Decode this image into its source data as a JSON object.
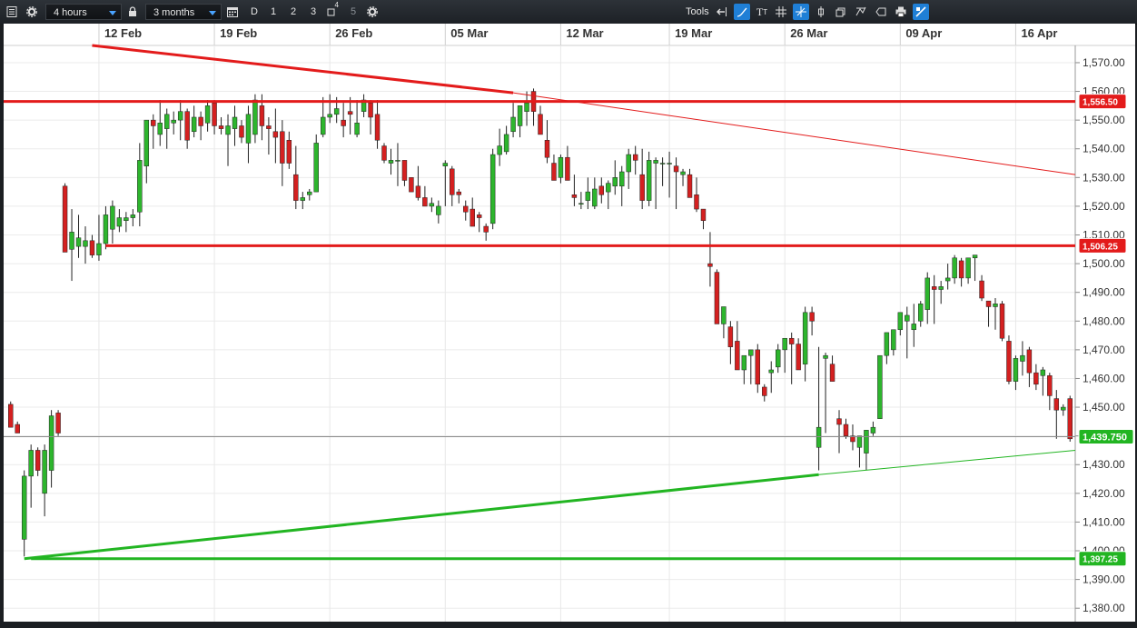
{
  "toolbar": {
    "interval": "4 hours",
    "range": "3 months",
    "periods": [
      "D",
      "1",
      "2",
      "3",
      "5"
    ],
    "period_superscript": "4",
    "tools_label": "Tools"
  },
  "colors": {
    "up": "#2db52d",
    "down": "#d42020",
    "resistance": "#e31b1b",
    "support": "#22b522",
    "last_price_bg": "#22b522"
  },
  "chart_data": {
    "type": "candlestick",
    "ylim": [
      1375,
      1576
    ],
    "y_ticks": [
      "1,570.00",
      "1,560.00",
      "1,550.00",
      "1,540.00",
      "1,530.00",
      "1,520.00",
      "1,510.00",
      "1,500.00",
      "1,490.00",
      "1,480.00",
      "1,470.00",
      "1,460.00",
      "1,450.00",
      "1,440.00",
      "1,430.00",
      "1,420.00",
      "1,410.00",
      "1,400.00",
      "1,390.00",
      "1,380.00"
    ],
    "x_labels": [
      "12 Feb",
      "19 Feb",
      "26 Feb",
      "05 Mar",
      "12 Mar",
      "19 Mar",
      "26 Mar",
      "09 Apr",
      "16 Apr"
    ],
    "price_tags": [
      {
        "label": "1,556.50",
        "value": 1556.5,
        "kind": "resistance"
      },
      {
        "label": "1,506.25",
        "value": 1506.25,
        "kind": "resistance"
      },
      {
        "label": "1,439.750",
        "value": 1439.75,
        "kind": "last"
      },
      {
        "label": "1,397.25",
        "value": 1397.25,
        "kind": "support"
      }
    ],
    "lines": [
      {
        "name": "upper-horizontal",
        "kind": "resistance",
        "y": 1556.5,
        "from_bar": 0,
        "to_bar": "end"
      },
      {
        "name": "middle-horizontal",
        "kind": "resistance",
        "y": 1506.25,
        "from_bar": 14,
        "to_bar": "end"
      },
      {
        "name": "lower-horizontal",
        "kind": "support",
        "y": 1397.25,
        "from_bar": 3,
        "to_bar": "end"
      },
      {
        "name": "last-price",
        "kind": "last",
        "y": 1439.75,
        "from_bar": 0,
        "to_bar": "end"
      },
      {
        "name": "descending-trendline",
        "kind": "resistance",
        "from": [
          12,
          1576
        ],
        "to": [
          74,
          1559.5
        ],
        "extend_to_y": 1531
      },
      {
        "name": "ascending-trendline",
        "kind": "support",
        "from": [
          2,
          1397.25
        ],
        "to": [
          119,
          1426.5
        ],
        "extend_to_y": 1435
      }
    ],
    "candles": [
      [
        1451,
        1452,
        1444,
        1443
      ],
      [
        1444,
        1445,
        1442,
        1441
      ],
      [
        1404,
        1428,
        1398,
        1426
      ],
      [
        1426,
        1437,
        1415,
        1435
      ],
      [
        1435,
        1436,
        1426,
        1428
      ],
      [
        1420,
        1437,
        1412,
        1435
      ],
      [
        1428,
        1449,
        1422,
        1447
      ],
      [
        1448,
        1449,
        1440,
        1441
      ],
      [
        1527,
        1528,
        1504,
        1504
      ],
      [
        1505,
        1519,
        1494,
        1511
      ],
      [
        1506,
        1517,
        1502,
        1509
      ],
      [
        1506,
        1513,
        1500,
        1508
      ],
      [
        1508,
        1510,
        1502,
        1503
      ],
      [
        1503,
        1517,
        1501,
        1507
      ],
      [
        1507,
        1520,
        1505,
        1517
      ],
      [
        1512,
        1522,
        1507,
        1520
      ],
      [
        1513,
        1519,
        1511,
        1516
      ],
      [
        1515,
        1518,
        1511,
        1516
      ],
      [
        1516,
        1519,
        1513,
        1517
      ],
      [
        1518,
        1542,
        1513,
        1536
      ],
      [
        1534,
        1550,
        1528,
        1550
      ],
      [
        1550,
        1552,
        1540,
        1548
      ],
      [
        1545,
        1557,
        1541,
        1549
      ],
      [
        1547,
        1554,
        1540,
        1552
      ],
      [
        1549,
        1553,
        1545,
        1550
      ],
      [
        1550,
        1557,
        1543,
        1553
      ],
      [
        1553,
        1554,
        1540,
        1543
      ],
      [
        1546,
        1555,
        1544,
        1551
      ],
      [
        1551,
        1553,
        1543,
        1548
      ],
      [
        1549,
        1557,
        1546,
        1555
      ],
      [
        1556,
        1557,
        1545,
        1548
      ],
      [
        1548,
        1551,
        1545,
        1547
      ],
      [
        1545,
        1552,
        1534,
        1548
      ],
      [
        1547,
        1555,
        1541,
        1551
      ],
      [
        1548,
        1550,
        1542,
        1544
      ],
      [
        1542,
        1555,
        1535,
        1552
      ],
      [
        1545,
        1559,
        1542,
        1557
      ],
      [
        1555,
        1559,
        1543,
        1548
      ],
      [
        1548,
        1551,
        1538,
        1547
      ],
      [
        1546,
        1554,
        1535,
        1544
      ],
      [
        1546,
        1550,
        1527,
        1535
      ],
      [
        1543,
        1546,
        1533,
        1535
      ],
      [
        1531,
        1541,
        1519,
        1522
      ],
      [
        1522,
        1525,
        1519,
        1523
      ],
      [
        1524,
        1526,
        1522,
        1525
      ],
      [
        1525,
        1545,
        1526,
        1542
      ],
      [
        1545,
        1558,
        1544,
        1551
      ],
      [
        1551,
        1559,
        1549,
        1552
      ],
      [
        1552,
        1558,
        1549,
        1554
      ],
      [
        1550,
        1556,
        1544,
        1548
      ],
      [
        1553,
        1558,
        1545,
        1552
      ],
      [
        1545,
        1557,
        1544,
        1549
      ],
      [
        1553,
        1559,
        1551,
        1557
      ],
      [
        1556,
        1557,
        1545,
        1551
      ],
      [
        1552,
        1557,
        1540,
        1543
      ],
      [
        1541,
        1542,
        1535,
        1536
      ],
      [
        1535,
        1540,
        1531,
        1536
      ],
      [
        1536,
        1542,
        1527,
        1536
      ],
      [
        1536,
        1536,
        1527,
        1529
      ],
      [
        1530,
        1530,
        1525,
        1525
      ],
      [
        1527,
        1534,
        1522,
        1523
      ],
      [
        1523,
        1527,
        1520,
        1520
      ],
      [
        1520,
        1523,
        1518,
        1521
      ],
      [
        1517,
        1522,
        1514,
        1520
      ],
      [
        1534,
        1536,
        1520,
        1535
      ],
      [
        1533,
        1534,
        1520,
        1524
      ],
      [
        1525,
        1526,
        1521,
        1524
      ],
      [
        1520,
        1522,
        1515,
        1518
      ],
      [
        1519,
        1523,
        1514,
        1513
      ],
      [
        1517,
        1518,
        1511,
        1516
      ],
      [
        1513,
        1514,
        1508,
        1511
      ],
      [
        1514,
        1540,
        1512,
        1538
      ],
      [
        1538,
        1547,
        1534,
        1541
      ],
      [
        1539,
        1548,
        1538,
        1545
      ],
      [
        1546,
        1556,
        1544,
        1551
      ],
      [
        1548,
        1553,
        1544,
        1555
      ],
      [
        1553,
        1560,
        1548,
        1556
      ],
      [
        1560,
        1561,
        1548,
        1553
      ],
      [
        1552,
        1555,
        1545,
        1545
      ],
      [
        1543,
        1550,
        1535,
        1537
      ],
      [
        1535,
        1538,
        1529,
        1529
      ],
      [
        1530,
        1538,
        1528,
        1537
      ],
      [
        1537,
        1541,
        1530,
        1529
      ],
      [
        1524,
        1531,
        1520,
        1523
      ],
      [
        1521,
        1525,
        1519,
        1521
      ],
      [
        1522,
        1530,
        1519,
        1525
      ],
      [
        1520,
        1530,
        1519,
        1526
      ],
      [
        1527,
        1530,
        1521,
        1524
      ],
      [
        1525,
        1529,
        1519,
        1528
      ],
      [
        1527,
        1536,
        1524,
        1530
      ],
      [
        1527,
        1534,
        1520,
        1532
      ],
      [
        1532,
        1540,
        1526,
        1538
      ],
      [
        1538,
        1541,
        1531,
        1536
      ],
      [
        1531,
        1540,
        1519,
        1522
      ],
      [
        1522,
        1539,
        1520,
        1536
      ],
      [
        1535,
        1537,
        1519,
        1536
      ],
      [
        1535,
        1537,
        1527,
        1535
      ],
      [
        1535,
        1539,
        1523,
        1535
      ],
      [
        1534,
        1537,
        1519,
        1532
      ],
      [
        1531,
        1533,
        1527,
        1532
      ],
      [
        1531,
        1533,
        1524,
        1523
      ],
      [
        1524,
        1530,
        1518,
        1519
      ],
      [
        1519,
        1517,
        1512,
        1515
      ],
      [
        1500,
        1511,
        1492,
        1499
      ],
      [
        1497,
        1498,
        1479,
        1479
      ],
      [
        1479,
        1485,
        1474,
        1485
      ],
      [
        1478,
        1480,
        1465,
        1471
      ],
      [
        1473,
        1480,
        1463,
        1463
      ],
      [
        1463,
        1466,
        1458,
        1468
      ],
      [
        1468,
        1470,
        1458,
        1470
      ],
      [
        1470,
        1472,
        1455,
        1458
      ],
      [
        1457,
        1458,
        1452,
        1454
      ],
      [
        1462,
        1466,
        1455,
        1463
      ],
      [
        1464,
        1472,
        1462,
        1470
      ],
      [
        1470,
        1473,
        1462,
        1474
      ],
      [
        1474,
        1476,
        1458,
        1472
      ],
      [
        1472,
        1474,
        1463,
        1463
      ],
      [
        1465,
        1485,
        1459,
        1483
      ],
      [
        1483,
        1485,
        1475,
        1480
      ],
      [
        1436,
        1471,
        1428,
        1443
      ],
      [
        1467,
        1469,
        1441,
        1468
      ],
      [
        1465,
        1468,
        1459,
        1459
      ],
      [
        1446,
        1449,
        1434,
        1444
      ],
      [
        1444,
        1446,
        1439,
        1440
      ],
      [
        1440,
        1444,
        1435,
        1438
      ],
      [
        1436,
        1437,
        1429,
        1440
      ],
      [
        1434,
        1441,
        1428,
        1442
      ],
      [
        1441,
        1445,
        1440,
        1443
      ],
      [
        1446,
        1462,
        1456,
        1468
      ],
      [
        1468,
        1471,
        1465,
        1476
      ],
      [
        1470,
        1476,
        1468,
        1477
      ],
      [
        1477,
        1481,
        1475,
        1483
      ],
      [
        1480,
        1485,
        1467,
        1482
      ],
      [
        1477,
        1486,
        1471,
        1479
      ],
      [
        1480,
        1487,
        1478,
        1486
      ],
      [
        1484,
        1497,
        1479,
        1495
      ],
      [
        1492,
        1496,
        1479,
        1491
      ],
      [
        1491,
        1494,
        1486,
        1492
      ],
      [
        1494,
        1500,
        1491,
        1495
      ],
      [
        1495,
        1503,
        1493,
        1502
      ],
      [
        1501,
        1502,
        1492,
        1495
      ],
      [
        1495,
        1502,
        1493,
        1502
      ],
      [
        1502,
        1502,
        1494,
        1503
      ],
      [
        1494,
        1496,
        1487,
        1488
      ],
      [
        1487,
        1486,
        1478,
        1485
      ],
      [
        1485,
        1488,
        1477,
        1486
      ],
      [
        1486,
        1487,
        1473,
        1474
      ],
      [
        1473,
        1475,
        1458,
        1459
      ],
      [
        1459,
        1468,
        1456,
        1467
      ],
      [
        1466,
        1473,
        1461,
        1468
      ],
      [
        1470,
        1471,
        1457,
        1462
      ],
      [
        1462,
        1465,
        1456,
        1458
      ],
      [
        1461,
        1464,
        1454,
        1463
      ],
      [
        1461,
        1462,
        1449,
        1454
      ],
      [
        1453,
        1456,
        1439,
        1449
      ],
      [
        1449,
        1451,
        1447,
        1450
      ],
      [
        1453,
        1454,
        1438,
        1439
      ]
    ]
  }
}
